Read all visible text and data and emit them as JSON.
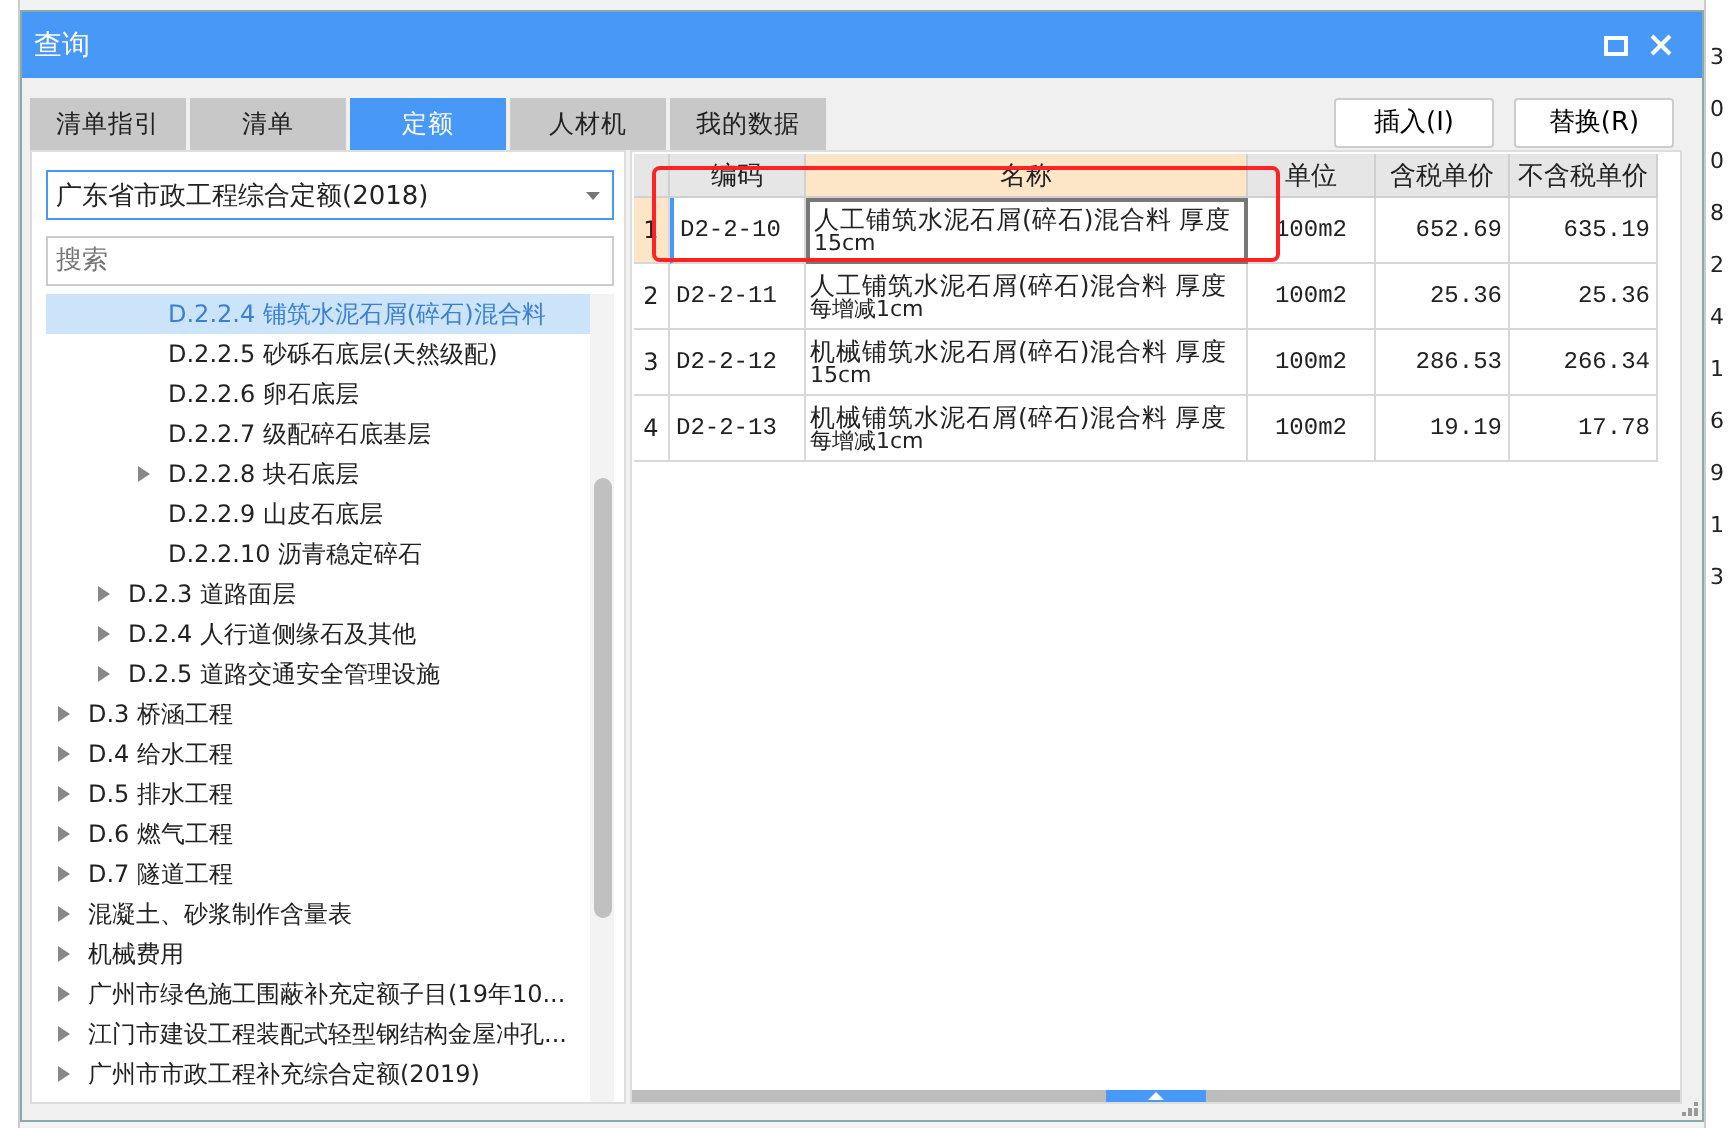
{
  "window": {
    "title": "查询"
  },
  "tabs": [
    {
      "label": "清单指引",
      "selected": false
    },
    {
      "label": "清单",
      "selected": false
    },
    {
      "label": "定额",
      "selected": true
    },
    {
      "label": "人材机",
      "selected": false
    },
    {
      "label": "我的数据",
      "selected": false
    }
  ],
  "actions": [
    "插入(I)",
    "替换(R)"
  ],
  "library_select": {
    "value": "广东省市政工程综合定额(2018)"
  },
  "search": {
    "placeholder": "搜索"
  },
  "tree": [
    {
      "children": [
        {
          "children": [
            {
              "label": "D.2.2.4 铺筑水泥石屑(碎石)混合料",
              "expandable": false,
              "selected": true
            },
            {
              "label": "D.2.2.5 砂砾石底层(天然级配)",
              "expandable": false,
              "selected": false
            },
            {
              "label": "D.2.2.6 卵石底层",
              "expandable": false,
              "selected": false
            },
            {
              "label": "D.2.2.7 级配碎石底基层",
              "expandable": false,
              "selected": false
            },
            {
              "label": "D.2.2.8 块石底层",
              "expandable": true,
              "selected": false
            },
            {
              "label": "D.2.2.9 山皮石底层",
              "expandable": false,
              "selected": false
            },
            {
              "label": "D.2.2.10 沥青稳定碎石",
              "expandable": false,
              "selected": false
            }
          ]
        },
        {
          "label": "D.2.3 道路面层",
          "expandable": true,
          "selected": false
        },
        {
          "label": "D.2.4 人行道侧缘石及其他",
          "expandable": true,
          "selected": false
        },
        {
          "label": "D.2.5 道路交通安全管理设施",
          "expandable": true,
          "selected": false
        }
      ]
    },
    {
      "label": "D.3 桥涵工程",
      "expandable": true,
      "selected": false
    },
    {
      "label": "D.4 给水工程",
      "expandable": true,
      "selected": false
    },
    {
      "label": "D.5 排水工程",
      "expandable": true,
      "selected": false
    },
    {
      "label": "D.6 燃气工程",
      "expandable": true,
      "selected": false
    },
    {
      "label": "D.7 隧道工程",
      "expandable": true,
      "selected": false
    },
    {
      "label": "混凝土、砂浆制作含量表",
      "expandable": true,
      "selected": false
    },
    {
      "label": "机械费用",
      "expandable": true,
      "selected": false
    },
    {
      "label": "广州市绿色施工围蔽补充定额子目(19年10...",
      "expandable": true,
      "selected": false
    },
    {
      "label": "江门市建设工程装配式轻型钢结构金屋冲孔...",
      "expandable": true,
      "selected": false
    },
    {
      "label": "广州市市政工程补充综合定额(2019)",
      "expandable": true,
      "selected": false
    }
  ],
  "table": {
    "columns": [
      "编码",
      "名称",
      "单位",
      "含税单价",
      "不含税单价"
    ],
    "rows": [
      {
        "index": "1",
        "code": "D2-2-10",
        "name": "人工铺筑水泥石屑(碎石)混合料 厚度",
        "name_2": "15cm",
        "unit": "100m2",
        "price_tax": "652.69",
        "price_notax": "635.19",
        "selected": true
      },
      {
        "index": "2",
        "code": "D2-2-11",
        "name": "人工铺筑水泥石屑(碎石)混合料 厚度",
        "name_2": "每增减1cm",
        "unit": "100m2",
        "price_tax": "25.36",
        "price_notax": "25.36",
        "selected": false
      },
      {
        "index": "3",
        "code": "D2-2-12",
        "name": "机械铺筑水泥石屑(碎石)混合料 厚度",
        "name_2": "15cm",
        "unit": "100m2",
        "price_tax": "286.53",
        "price_notax": "266.34",
        "selected": false
      },
      {
        "index": "4",
        "code": "D2-2-13",
        "name": "机械铺筑水泥石屑(碎石)混合料 厚度",
        "name_2": "每增减1cm",
        "unit": "100m2",
        "price_tax": "19.19",
        "price_notax": "17.78",
        "selected": false
      }
    ]
  },
  "background_cells": [
    "3",
    "0",
    "0",
    "8",
    "2",
    "4",
    "1",
    "6",
    "9",
    "1",
    "3"
  ]
}
